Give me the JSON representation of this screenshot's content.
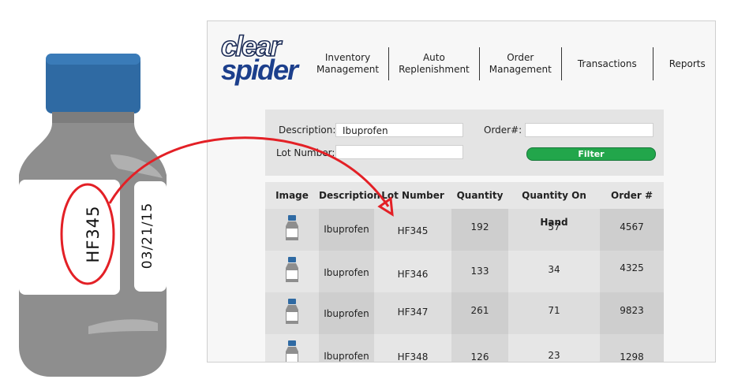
{
  "bottle": {
    "lot_text": "HF345",
    "date_text": "03/21/15",
    "colors": {
      "cap": "#2f6aa3",
      "body": "#8e8e8e",
      "label": "#ffffff",
      "highlight": "#e32026"
    }
  },
  "app": {
    "logo": {
      "line1": "clear",
      "line2": "spider"
    },
    "nav": [
      {
        "line1": "Inventory",
        "line2": "Management"
      },
      {
        "line1": "Auto",
        "line2": "Replenishment"
      },
      {
        "line1": "Order",
        "line2": "Management"
      },
      {
        "line1": "Transactions",
        "line2": ""
      },
      {
        "line1": "Reports",
        "line2": ""
      }
    ],
    "filter": {
      "description_label": "Description:",
      "description_value": "Ibuprofen",
      "order_label": "Order#:",
      "order_value": "",
      "lot_label": "Lot Number:",
      "lot_value": "",
      "button": "Filter",
      "button_color": "#22a64b"
    },
    "table": {
      "headers": [
        "Image",
        "Description",
        "Lot Number",
        "Quantity",
        "Quantity On Hand",
        "Order #"
      ],
      "rows": [
        {
          "description": "Ibuprofen",
          "lot": "HF345",
          "quantity": "192",
          "on_hand": "57",
          "order": "4567"
        },
        {
          "description": "Ibuprofen",
          "lot": "HF346",
          "quantity": "133",
          "on_hand": "34",
          "order": "4325"
        },
        {
          "description": "Ibuprofen",
          "lot": "HF347",
          "quantity": "261",
          "on_hand": "71",
          "order": "9823"
        },
        {
          "description": "Ibuprofen",
          "lot": "HF348",
          "quantity": "126",
          "on_hand": "23",
          "order": "1298"
        }
      ]
    }
  }
}
